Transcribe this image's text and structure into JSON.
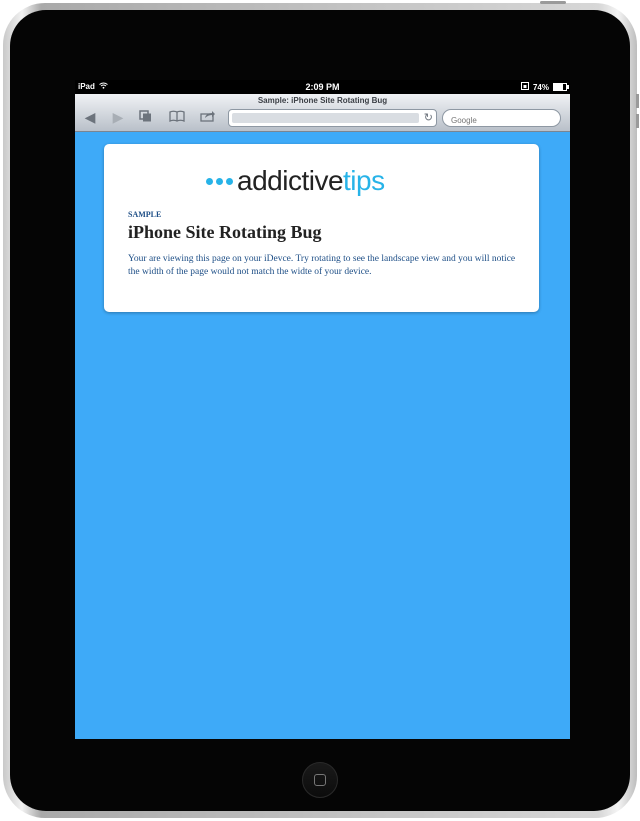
{
  "status": {
    "carrier": "iPad",
    "time": "2:09 PM",
    "battery_pct_text": "74%",
    "battery_level": 0.74
  },
  "browser": {
    "page_title": "Sample: iPhone Site Rotating Bug",
    "url": "",
    "search_placeholder": "Google",
    "icons": [
      "back-icon",
      "forward-icon",
      "pages-icon",
      "bookmarks-icon",
      "share-icon",
      "reload-icon"
    ]
  },
  "page": {
    "logo_text_dark": "addictive",
    "logo_text_accent": "tips",
    "tag": "SAMPLE",
    "headline": "iPhone Site Rotating Bug",
    "body": "Your are viewing this page on your iDevce. Try rotating to see the landscape view and you will notice the width of the page would not match the widte of your device."
  },
  "colors": {
    "page_background": "#3eaaf8",
    "brand_accent": "#27b3e8",
    "heading_blue": "#1d4e86"
  }
}
